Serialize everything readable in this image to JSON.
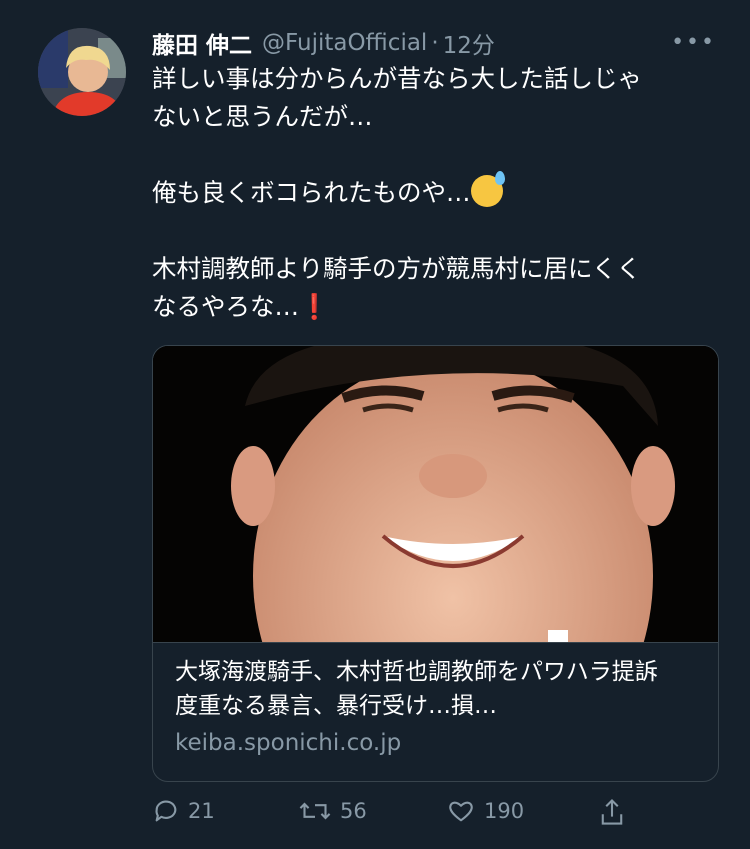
{
  "tweet": {
    "author_name": "藤田 伸二",
    "handle": "@FujitaOfficial",
    "separator": "·",
    "time": "12分",
    "more_label": "•••",
    "lines": [
      "詳しい事は分からんが昔なら大した話しじゃ",
      "ないと思うんだが…",
      "",
      "俺も良くボコられたものや…",
      "",
      "木村調教師より騎手の方が競馬村に居にくく",
      "なるやろな…"
    ],
    "emoji_after_line4": "sweat-smile",
    "emoji_after_line7": "red-exclamation"
  },
  "card": {
    "title": "大塚海渡騎手、木村哲也調教師をパワハラ提訴　度重なる暴言、暴行受け…損…",
    "domain": "keiba.sponichi.co.jp"
  },
  "actions": {
    "reply_count": "21",
    "retweet_count": "56",
    "like_count": "190"
  },
  "colors": {
    "background": "#15202b",
    "text_secondary": "#8899a6",
    "border": "#38444d"
  }
}
